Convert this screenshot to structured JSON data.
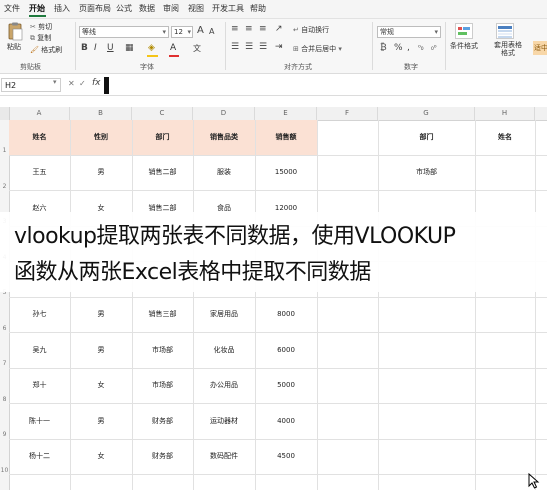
{
  "menu": {
    "items": [
      "文件",
      "开始",
      "插入",
      "页面布局",
      "公式",
      "数据",
      "审阅",
      "视图",
      "开发工具",
      "帮助"
    ],
    "active_index": 1
  },
  "ribbon": {
    "clipboard": {
      "paste": "粘贴",
      "cut": "剪切",
      "copy": "复制",
      "format_painter": "格式刷",
      "label": "剪贴板"
    },
    "font": {
      "font_name": "等线",
      "font_size": "12",
      "bold": "B",
      "italic": "I",
      "underline": "U",
      "grow": "A",
      "shrink": "A",
      "label": "字体"
    },
    "alignment": {
      "wrap": "自动换行",
      "merge": "合并后居中",
      "label": "对齐方式"
    },
    "number": {
      "format": "常规",
      "percent": "%",
      "comma": ",",
      "label": "数字"
    },
    "styles": {
      "conditional": "条件格式",
      "table": "套用表格格式",
      "cell_style": "适中"
    }
  },
  "formula_bar": {
    "name_box": "H2",
    "fx": "fx",
    "content": ""
  },
  "grid": {
    "columns": [
      "A",
      "B",
      "C",
      "D",
      "E",
      "F",
      "G",
      "H"
    ],
    "row_numbers": [
      "1",
      "2",
      "3",
      "4",
      "5",
      "6",
      "7",
      "8",
      "9",
      "10"
    ],
    "headers": [
      "姓名",
      "性别",
      "部门",
      "销售品类",
      "销售额"
    ],
    "rows": [
      [
        "王五",
        "男",
        "销售二部",
        "服装",
        "15000"
      ],
      [
        "赵六",
        "女",
        "销售二部",
        "食品",
        "12000"
      ],
      [
        "",
        "",
        "",
        "",
        ""
      ],
      [
        "孙七",
        "男",
        "销售三部",
        "家居用品",
        "8000"
      ],
      [
        "吴九",
        "男",
        "市场部",
        "化妆品",
        "6000"
      ],
      [
        "郑十",
        "女",
        "市场部",
        "办公用品",
        "5000"
      ],
      [
        "陈十一",
        "男",
        "财务部",
        "运动器材",
        "4000"
      ],
      [
        "杨十二",
        "女",
        "财务部",
        "数码配件",
        "4500"
      ]
    ],
    "lookup_headers": [
      "部门",
      "姓名"
    ],
    "lookup_rows": [
      [
        "市场部",
        ""
      ]
    ]
  },
  "overlay": {
    "line1": "vlookup提取两张表不同数据，使用VLOOKUP",
    "line2": "函数从两张Excel表格中提取不同数据"
  },
  "colors": {
    "accent": "#1f7a3e",
    "header_fill": "#fbe1d4",
    "font_color": "#e03030",
    "highlight": "#f5c518",
    "cell_style": "#f8d7a8"
  }
}
